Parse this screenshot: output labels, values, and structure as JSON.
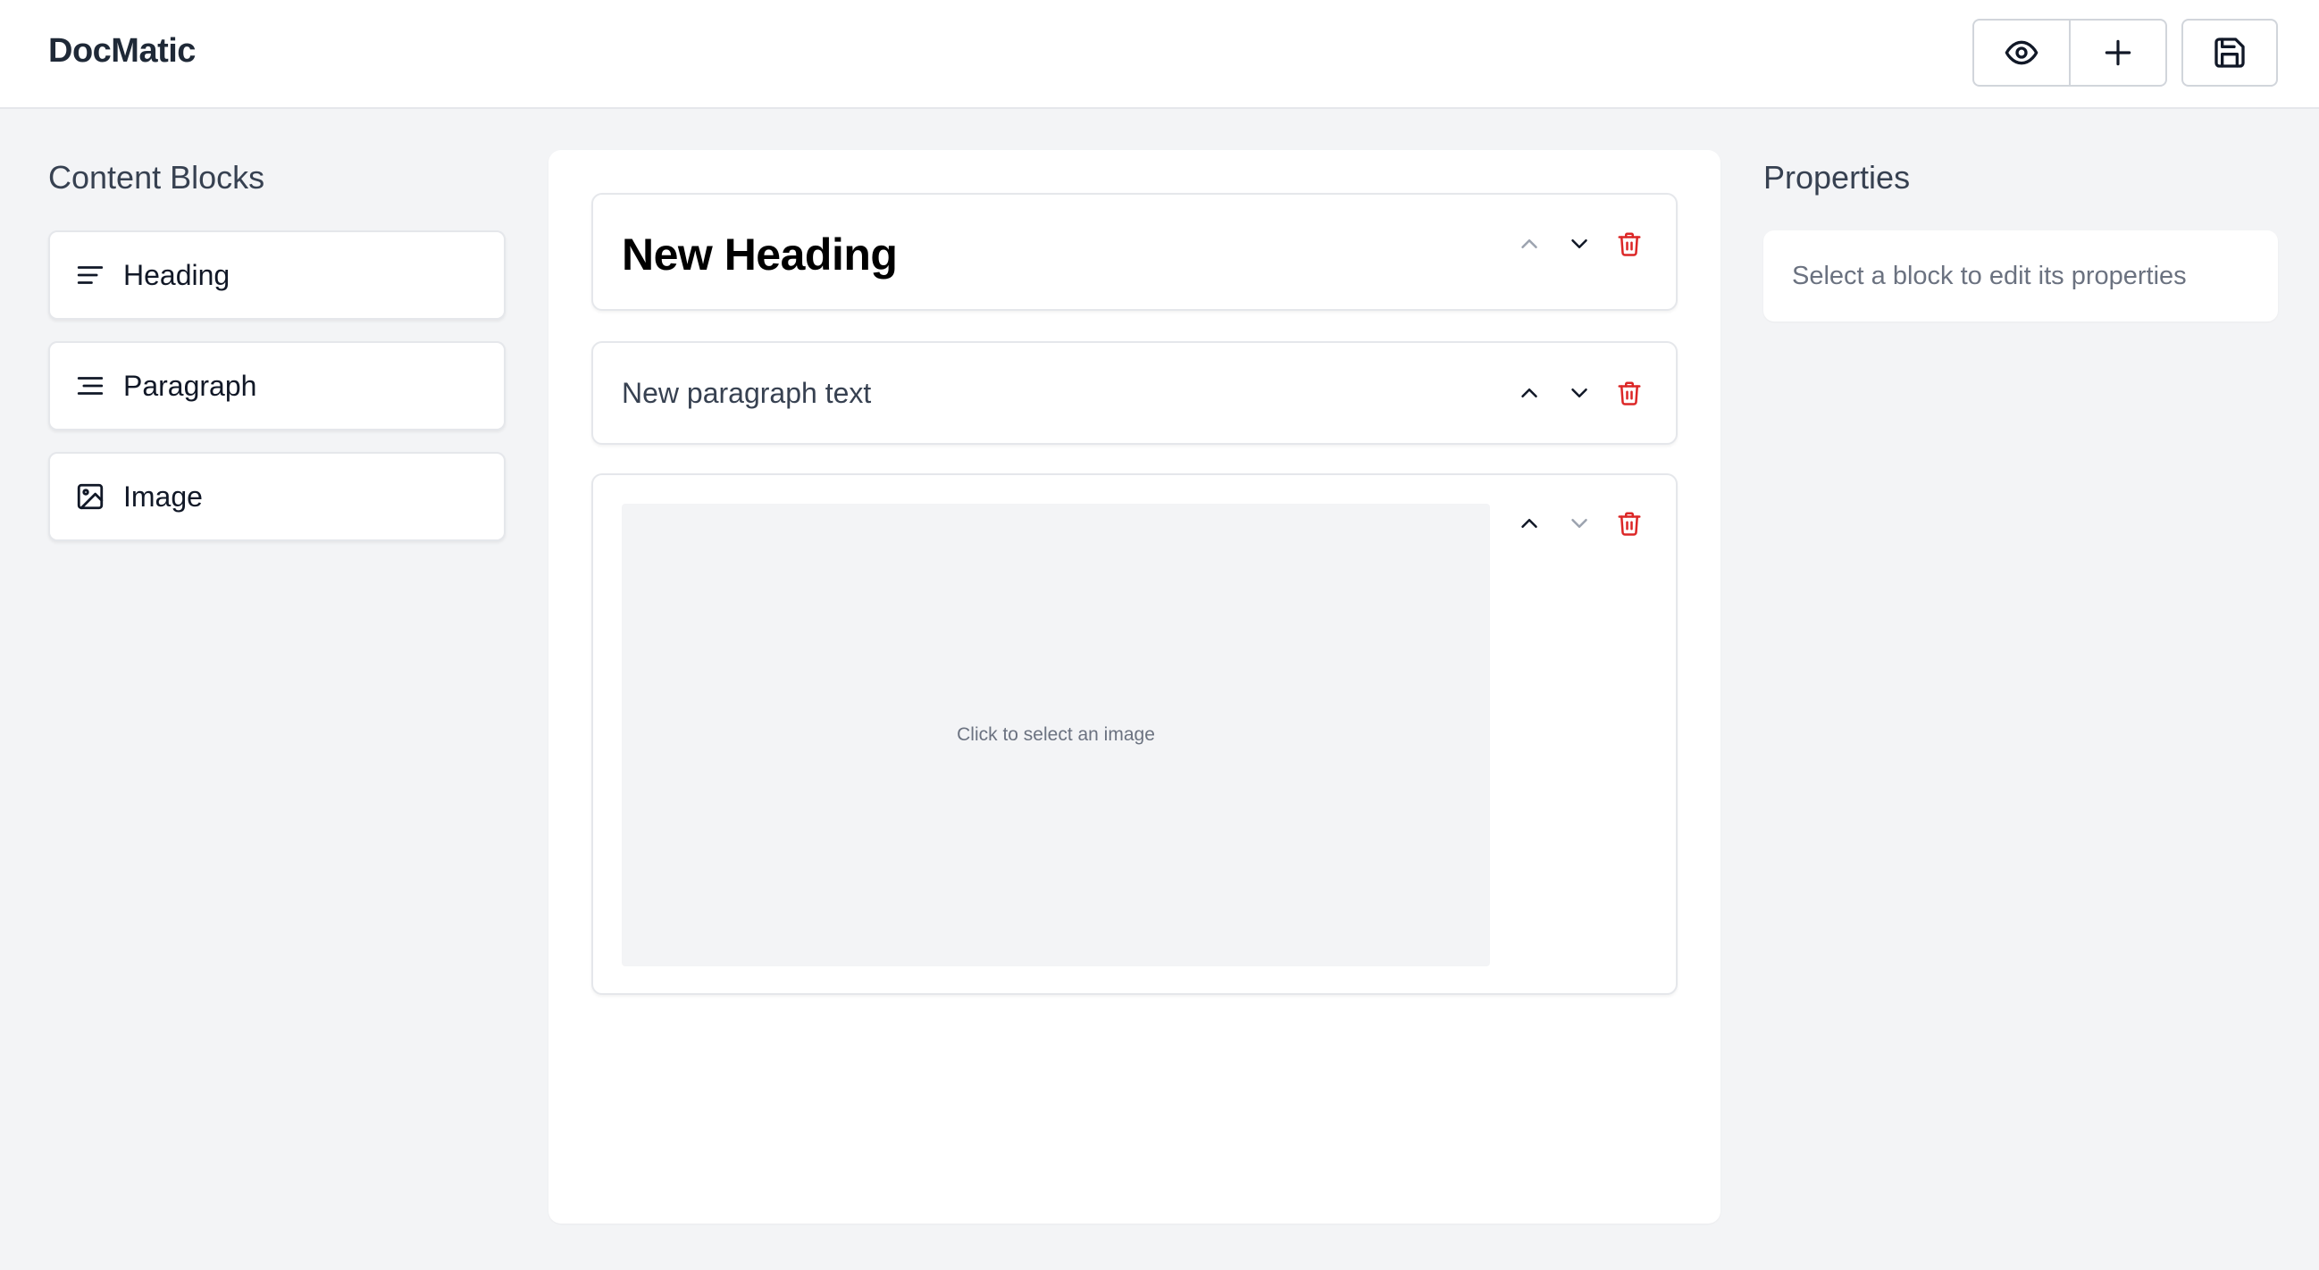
{
  "app": {
    "title": "DocMatic"
  },
  "toolbar": {
    "preview_icon": "eye-icon",
    "add_icon": "plus-icon",
    "save_icon": "floppy-disk-icon"
  },
  "sidebar": {
    "title": "Content Blocks",
    "items": [
      {
        "label": "Heading",
        "icon": "align-left-icon"
      },
      {
        "label": "Paragraph",
        "icon": "align-right-icon"
      },
      {
        "label": "Image",
        "icon": "image-icon"
      }
    ]
  },
  "canvas": {
    "blocks": [
      {
        "type": "heading",
        "text": "New Heading",
        "move_up_enabled": false,
        "move_down_enabled": true
      },
      {
        "type": "paragraph",
        "text": "New paragraph text",
        "move_up_enabled": true,
        "move_down_enabled": true
      },
      {
        "type": "image",
        "placeholder": "Click to select an image",
        "move_up_enabled": true,
        "move_down_enabled": false
      }
    ]
  },
  "properties": {
    "title": "Properties",
    "empty_message": "Select a block to edit its properties"
  },
  "colors": {
    "background": "#f3f4f6",
    "delete": "#dc2626",
    "text_primary": "#1f2937",
    "text_muted": "#6b7280",
    "disabled_icon": "#9ca3af"
  }
}
